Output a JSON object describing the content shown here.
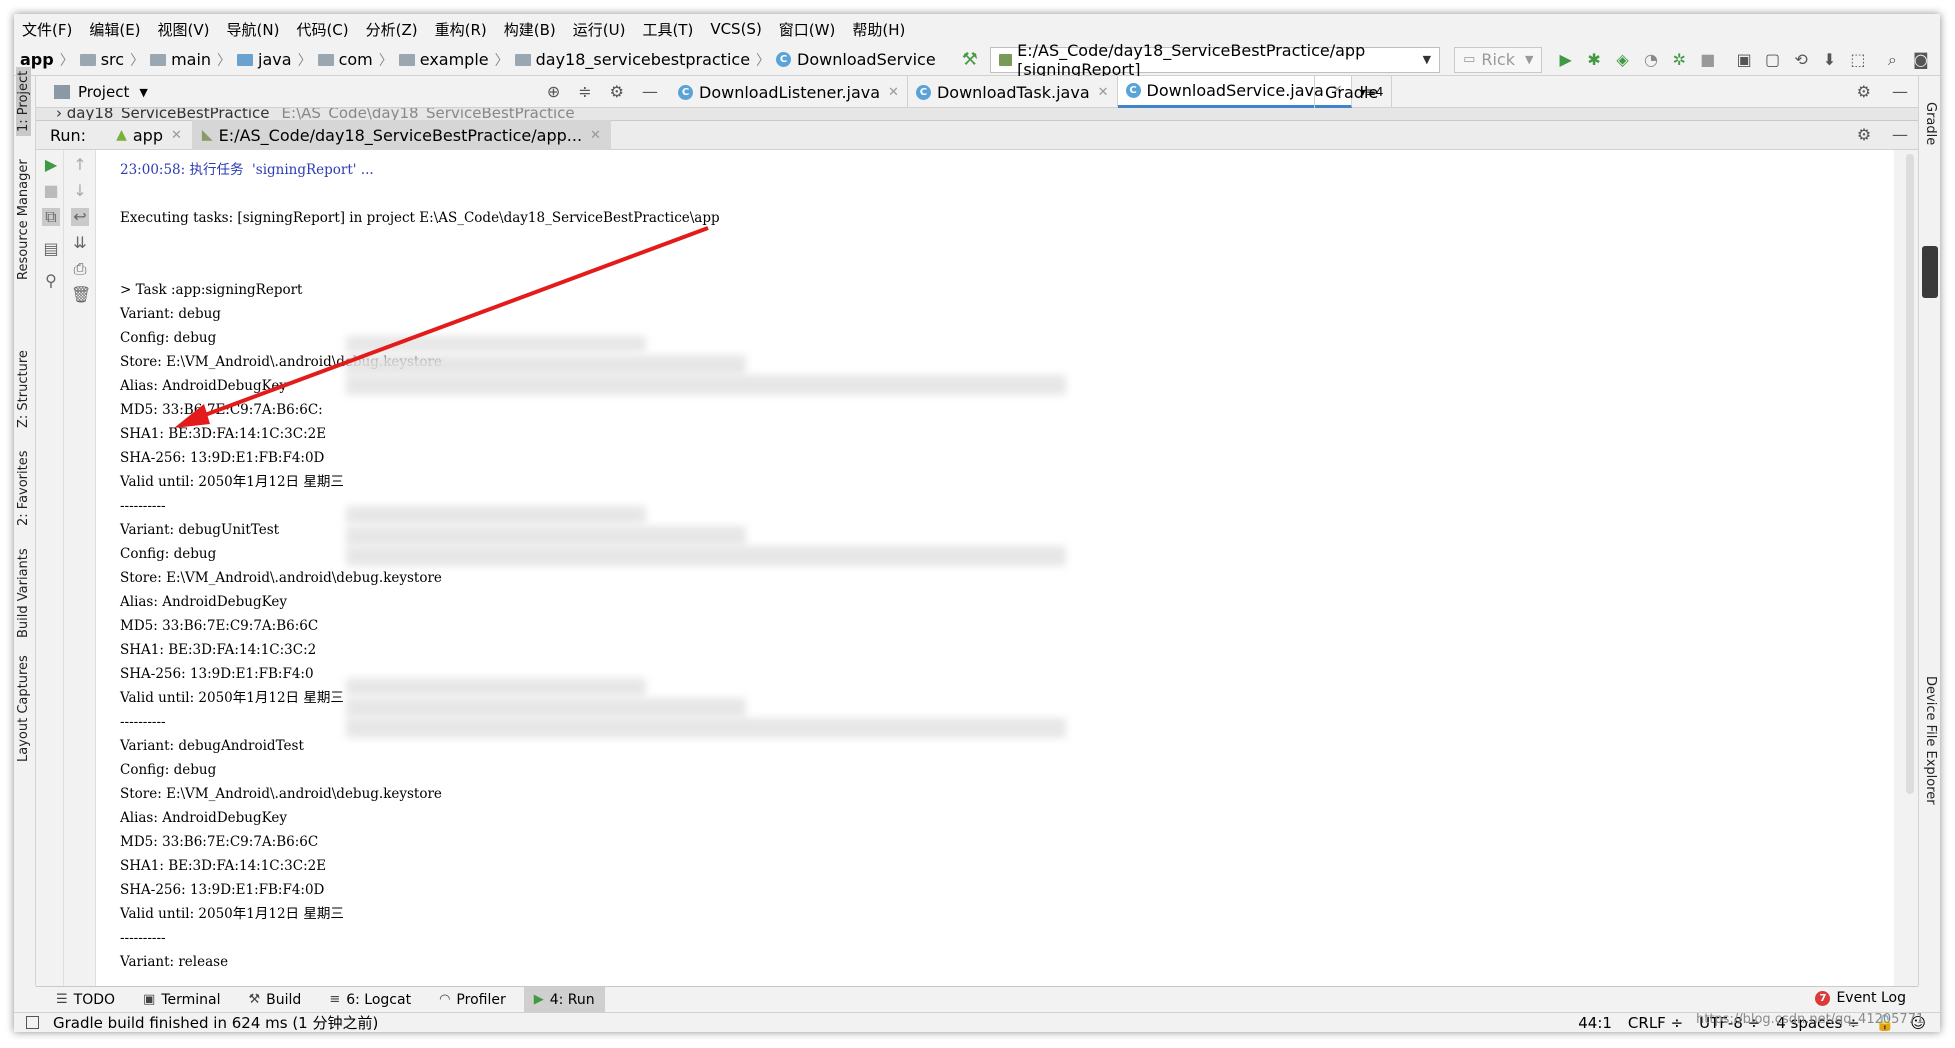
{
  "menu": [
    "文件(F)",
    "编辑(E)",
    "视图(V)",
    "导航(N)",
    "代码(C)",
    "分析(Z)",
    "重构(R)",
    "构建(B)",
    "运行(U)",
    "工具(T)",
    "VCS(S)",
    "窗口(W)",
    "帮助(H)"
  ],
  "breadcrumbs": [
    "app",
    "src",
    "main",
    "java",
    "com",
    "example",
    "day18_servicebestpractice",
    "DownloadService"
  ],
  "run_config": "E:/AS_Code/day18_ServiceBestPractice/app [signingReport]",
  "device": "Rick",
  "project_panel": {
    "title": "Project",
    "root_item": "day18_ServiceBestPractice",
    "root_path": "E:\\AS_Code\\day18_ServiceBestPractice"
  },
  "editor_tabs": [
    {
      "label": "DownloadListener.java",
      "active": false
    },
    {
      "label": "DownloadTask.java",
      "active": false
    },
    {
      "label": "DownloadService.java",
      "active": true
    }
  ],
  "tab_overflow": "4",
  "gradle_title": "Gradle",
  "run_window": {
    "label": "Run:",
    "tabs": [
      "app",
      "E:/AS_Code/day18_ServiceBestPractice/app..."
    ]
  },
  "left_stripe": [
    "1: Project",
    "Resource Manager",
    "Z: Structure",
    "2: Favorites",
    "Build Variants",
    "Layout Captures"
  ],
  "right_stripe": [
    "Gradle",
    "Device File Explorer"
  ],
  "console_lines": [
    "23:00:58: 执行任务  'signingReport' ...",
    "",
    "Executing tasks: [signingReport] in project E:\\AS_Code\\day18_ServiceBestPractice\\app",
    "",
    "",
    "> Task :app:signingReport",
    "Variant: debug",
    "Config: debug",
    "Store: E:\\VM_Android\\.android\\debug.keystore",
    "Alias: AndroidDebugKey",
    "MD5: 33:B6:7E:C9:7A:B6:6C:",
    "SHA1: BE:3D:FA:14:1C:3C:2E",
    "SHA-256: 13:9D:E1:FB:F4:0D",
    "Valid until: 2050年1月12日 星期三",
    "----------",
    "Variant: debugUnitTest",
    "Config: debug",
    "Store: E:\\VM_Android\\.android\\debug.keystore",
    "Alias: AndroidDebugKey",
    "MD5: 33:B6:7E:C9:7A:B6:6C",
    "SHA1: BE:3D:FA:14:1C:3C:2",
    "SHA-256: 13:9D:E1:FB:F4:0",
    "Valid until: 2050年1月12日 星期三",
    "----------",
    "Variant: debugAndroidTest",
    "Config: debug",
    "Store: E:\\VM_Android\\.android\\debug.keystore",
    "Alias: AndroidDebugKey",
    "MD5: 33:B6:7E:C9:7A:B6:6C",
    "SHA1: BE:3D:FA:14:1C:3C:2E",
    "SHA-256: 13:9D:E1:FB:F4:0D",
    "Valid until: 2050年1月12日 星期三",
    "----------",
    "Variant: release"
  ],
  "bottom_tabs": [
    "TODO",
    "Terminal",
    "Build",
    "6: Logcat",
    "Profiler",
    "4: Run"
  ],
  "event_log": "Event Log",
  "event_log_count": "7",
  "status": {
    "message": "Gradle build finished in 624 ms (1 分钟之前)",
    "position": "44:1",
    "line_sep": "CRLF ÷",
    "encoding": "UTF-8 ÷",
    "indent": "4 spaces ÷"
  },
  "watermark": "https://blog.csdn.net/qq_41205771",
  "colors": {
    "accent": "#4083c9",
    "arrow": "#e31b1b",
    "blue_text": "#2b3bb3"
  }
}
